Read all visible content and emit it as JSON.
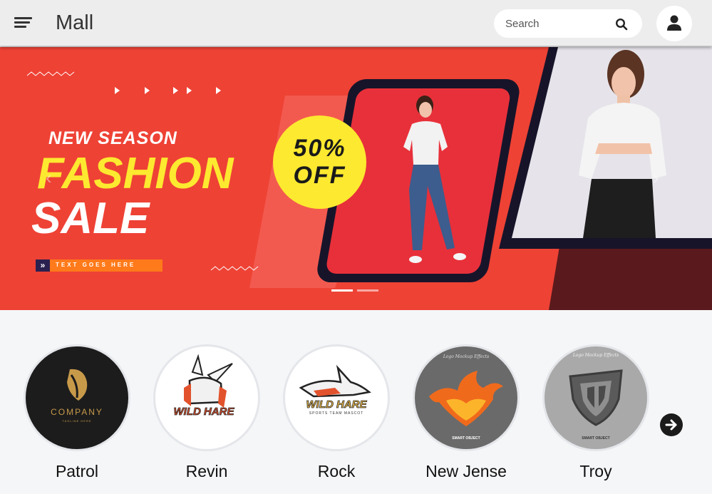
{
  "header": {
    "title": "Mall",
    "search_placeholder": "Search"
  },
  "banner": {
    "line1": "NEW SEASON",
    "line2": "FASHION",
    "line3": "SALE",
    "tagline": "TEXT GOES HERE",
    "badge_line1": "50%",
    "badge_line2": "OFF",
    "slide_count": 2,
    "active_slide": 1
  },
  "brands": {
    "items": [
      {
        "name": "Patrol",
        "logo_text": "COMPANY",
        "logo_sub": "TAGLINE HERE"
      },
      {
        "name": "Revin",
        "logo_text": "WILD HARE"
      },
      {
        "name": "Rock",
        "logo_text": "WILD HARE",
        "logo_sub": "SPORTS TEAM MASCOT"
      },
      {
        "name": "New Jense",
        "logo_text": "Logo Mockup Effects",
        "logo_sub": "SMART OBJECT"
      },
      {
        "name": "Troy",
        "logo_text": "Logo Mockup Effects",
        "logo_sub": "SMART OBJECT"
      }
    ]
  },
  "colors": {
    "banner_red": "#ee4235",
    "banner_yellow": "#fde92f",
    "header_bg": "#ededed"
  }
}
